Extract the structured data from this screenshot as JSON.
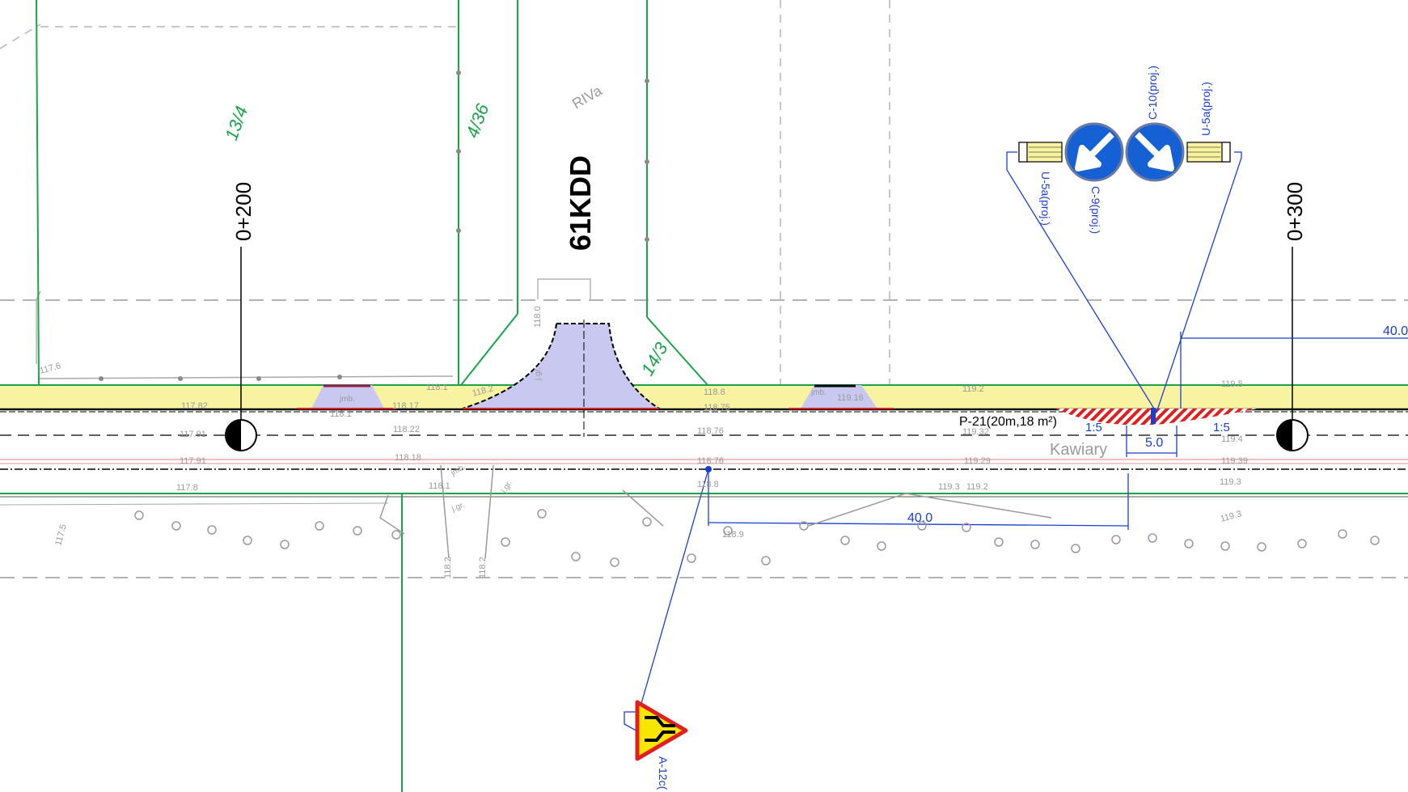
{
  "road": {
    "name": "61KDD",
    "chainage": [
      "0+200",
      "0+300"
    ],
    "street_name": "Kawiary",
    "faint_label": "RIVa"
  },
  "parcels": [
    "13/4",
    "4/36",
    "14/3"
  ],
  "signs": {
    "a12c": "A-12c(",
    "c9": "C-9(proj.)",
    "c10": "C-10(proj.)",
    "u5a_left": "U-5a(proj.)",
    "u5a_right": "U-5a(proj.)"
  },
  "dimensions": {
    "upper_40": "40.0",
    "lower_40": "40.0",
    "island_width": "5.0",
    "slope_left": "1:5",
    "slope_right": "1:5"
  },
  "marking": {
    "label": "P-21(20m,18 m²)"
  },
  "elevations": {
    "row1": [
      {
        "t": "117.6"
      },
      {
        "t": "117.82"
      },
      {
        "t": "118.17"
      },
      {
        "t": "118.1"
      },
      {
        "t": "118.2"
      },
      {
        "t": "118.8"
      },
      {
        "t": "119.2"
      },
      {
        "t": "119.5"
      }
    ],
    "row2": [
      {
        "t": "117.91"
      },
      {
        "t": "118.22"
      },
      {
        "t": "118.76"
      },
      {
        "t": "119.32"
      },
      {
        "t": "119.4"
      }
    ],
    "row3": [
      {
        "t": "117.91"
      },
      {
        "t": "118.18"
      },
      {
        "t": "118.76"
      },
      {
        "t": "119.29"
      },
      {
        "t": "119.39"
      }
    ],
    "row4": [
      {
        "t": "117.8"
      },
      {
        "t": "118.1"
      },
      {
        "t": "118.8"
      },
      {
        "t": "119.2"
      },
      {
        "t": "119.3"
      },
      {
        "t": "119.3"
      }
    ],
    "misc": [
      {
        "t": "117.5"
      },
      {
        "t": "118.2"
      },
      {
        "t": "118.2"
      },
      {
        "t": "118.9"
      },
      {
        "t": "119.3"
      },
      {
        "t": "118.0"
      },
      {
        "t": "118.75"
      },
      {
        "t": "119.16"
      },
      {
        "t": "118.1"
      }
    ]
  },
  "small_labels": {
    "inlet1": "jmb.",
    "inlet2": "jmb.",
    "inlet3": "jmb.",
    "jgr1": "j.gr.",
    "jgr2": "j.gr.",
    "jgr3": "j.gr."
  },
  "colors": {
    "parcel_line": "#1aa34a",
    "sidewalk_fill": "#f7f3a0",
    "island_fill": "#c8c8f0",
    "hatch_red": "#e02020",
    "dimension_blue": "#1a3fd0",
    "sign_blue": "#1560d4",
    "warning_yellow": "#f7e600"
  }
}
